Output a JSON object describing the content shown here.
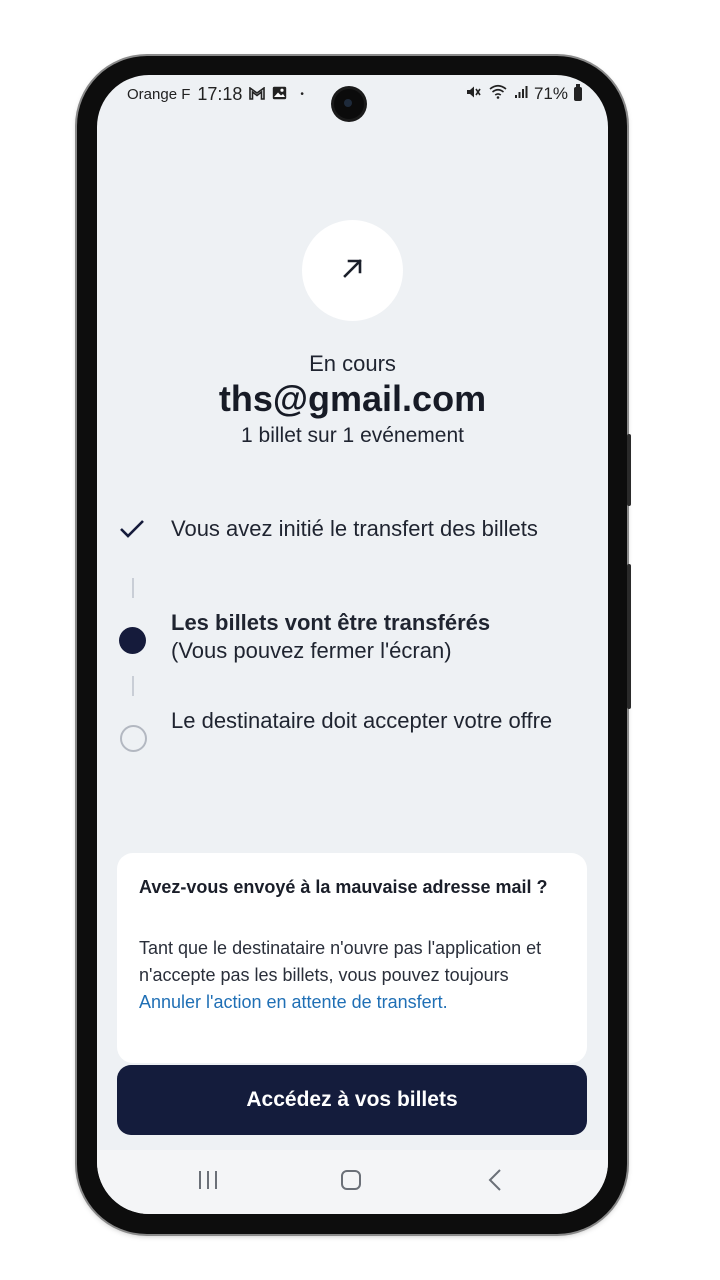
{
  "status_bar": {
    "carrier": "Orange F",
    "time": "17:18",
    "notification_icons": [
      "gmail-icon",
      "gallery-icon"
    ],
    "dot": "•",
    "battery": "71%"
  },
  "transfer": {
    "icon": "arrow-up-right-icon",
    "status": "En cours",
    "recipient_email": "ths@gmail.com",
    "summary": "1 billet sur 1 evénement"
  },
  "steps": [
    {
      "state": "done",
      "text": "Vous avez initié le transfert des billets"
    },
    {
      "state": "current",
      "text": "Les billets vont être transférés",
      "subtext": "(Vous pouvez fermer l'écran)"
    },
    {
      "state": "pending",
      "text": "Le destinataire doit accepter votre offre"
    }
  ],
  "info_card": {
    "title": "Avez-vous envoyé à la mauvaise adresse mail ?",
    "body": "Tant que le destinataire n'ouvre pas l'application et n'accepte pas les billets, vous pouvez toujours ",
    "link": "Annuler l'action en attente de transfert."
  },
  "primary_button": {
    "label": "Accédez à vos billets"
  },
  "colors": {
    "accent_navy": "#141c3c",
    "link_blue": "#1f6fb5",
    "background": "#eef1f4"
  }
}
